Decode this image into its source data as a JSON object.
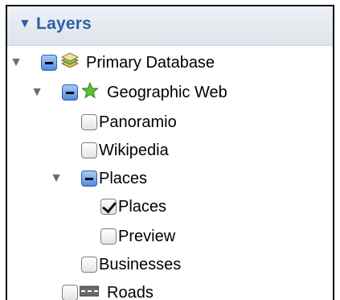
{
  "panel": {
    "title": "Layers",
    "title_disclosure": "▼"
  },
  "tree": [
    {
      "label": "Primary Database",
      "state": "mixed",
      "expanded": true,
      "icon": "database-layers-icon"
    },
    {
      "label": "Geographic Web",
      "state": "mixed",
      "expanded": true,
      "icon": "star-icon"
    },
    {
      "label": "Panoramio",
      "state": "unchecked"
    },
    {
      "label": "Wikipedia",
      "state": "unchecked"
    },
    {
      "label": "Places",
      "state": "mixed",
      "expanded": true
    },
    {
      "label": "Places",
      "state": "checked"
    },
    {
      "label": "Preview",
      "state": "unchecked"
    },
    {
      "label": "Businesses",
      "state": "unchecked"
    },
    {
      "label": "Roads",
      "state": "unchecked",
      "icon": "road-icon"
    }
  ],
  "colors": {
    "accent": "#2f5fa8",
    "checkbox_mixed": "#4f8ae0",
    "star": "#5cc23a"
  }
}
